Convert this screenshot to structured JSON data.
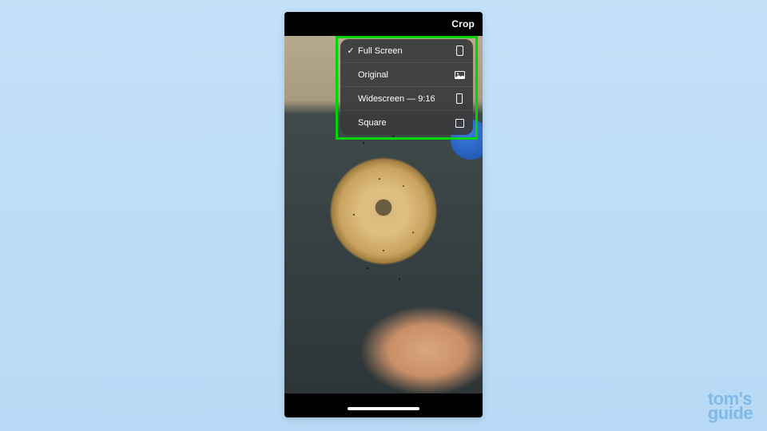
{
  "header": {
    "crop_label": "Crop"
  },
  "dropdown": {
    "items": [
      {
        "label": "Full Screen",
        "selected": true,
        "icon": "phone-portrait-icon"
      },
      {
        "label": "Original",
        "selected": false,
        "icon": "image-icon"
      },
      {
        "label": "Widescreen — 9:16",
        "selected": false,
        "icon": "phone-tall-icon"
      },
      {
        "label": "Square",
        "selected": false,
        "icon": "square-icon"
      }
    ],
    "check_glyph": "✓"
  },
  "watermark": {
    "line1": "tom's",
    "line2": "guide"
  }
}
